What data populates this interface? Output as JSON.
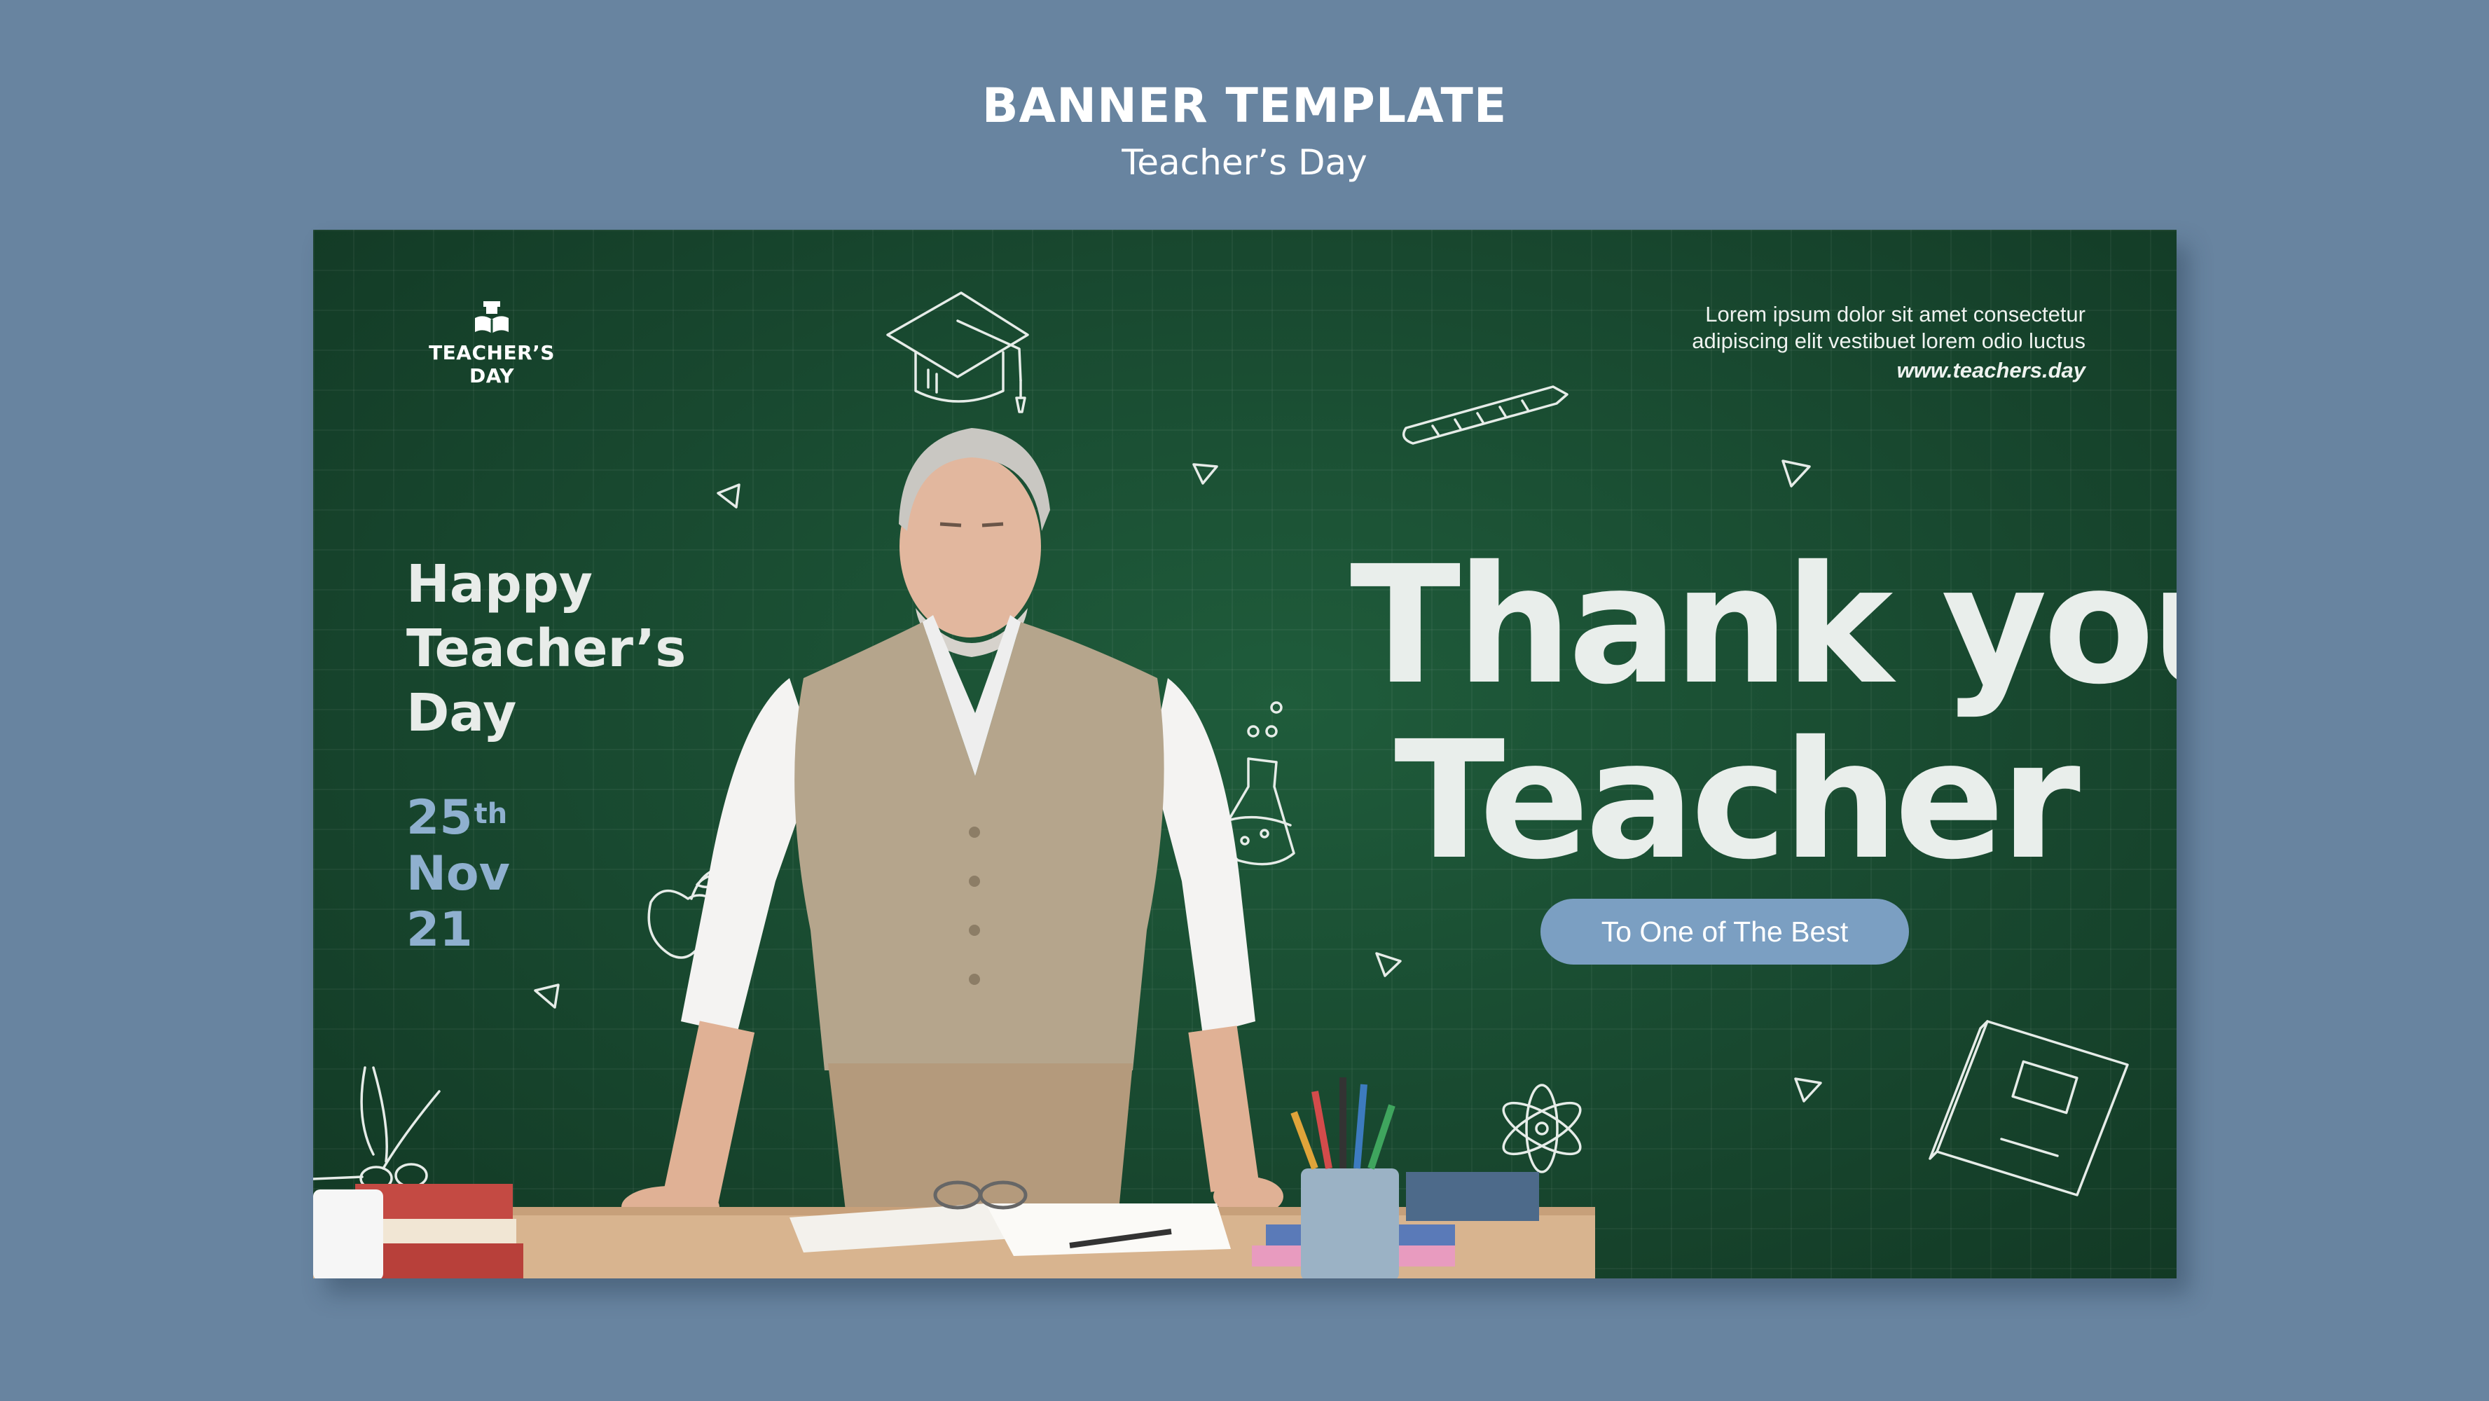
{
  "header": {
    "title": "BANNER TEMPLATE",
    "subtitle": "Teacher’s Day"
  },
  "banner": {
    "brand": {
      "logo_icon": "book-graduation-icon",
      "text": "TEACHER’S DAY"
    },
    "greeting": {
      "line1": "Happy",
      "line2": "Teacher’s",
      "line3": "Day"
    },
    "date": {
      "day": "25",
      "suffix": "th",
      "month": "Nov",
      "year": "21"
    },
    "info": {
      "line1": "Lorem ipsum dolor sit amet consectetur",
      "line2": "adipiscing elit vestibuet lorem odio luctus",
      "url": "www.teachers.day"
    },
    "headline": {
      "line1": "Thank you",
      "line2": "Teacher"
    },
    "cta": "To One of The Best",
    "colors": {
      "page_background": "#6884a0",
      "chalkboard": "#1a4d33",
      "headline_text": "#e9eeeb",
      "date_text": "#8fb0cf",
      "pill_background": "#7b9fc2"
    },
    "doodles": [
      "graduation-cap-icon",
      "pencil-icon",
      "triangle-icon",
      "flask-icon",
      "apple-icon",
      "scissors-icon",
      "atom-icon",
      "notebook-icon"
    ]
  }
}
